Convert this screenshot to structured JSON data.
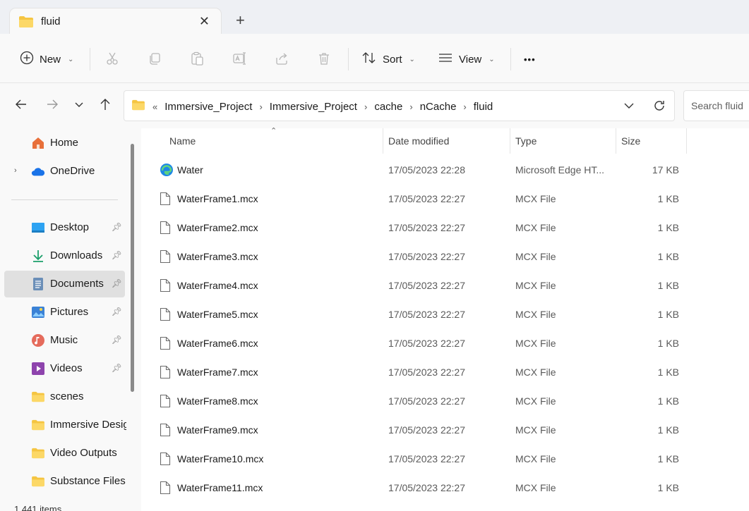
{
  "tab": {
    "title": "fluid",
    "close": "✕",
    "new_tab": "+"
  },
  "toolbar": {
    "new_label": "New",
    "sort_label": "Sort",
    "view_label": "View",
    "more_label": "•••"
  },
  "address": {
    "overflow": "«",
    "crumbs": [
      "Immersive_Project",
      "Immersive_Project",
      "cache",
      "nCache",
      "fluid"
    ],
    "separator": "›"
  },
  "search": {
    "placeholder": "Search fluid"
  },
  "sidebar": {
    "items": [
      {
        "label": "Home",
        "icon": "home-icon"
      },
      {
        "label": "OneDrive",
        "icon": "cloud-icon"
      },
      {
        "label": "Desktop",
        "icon": "desktop-icon",
        "pinned": true
      },
      {
        "label": "Downloads",
        "icon": "download-icon",
        "pinned": true
      },
      {
        "label": "Documents",
        "icon": "document-icon",
        "pinned": true,
        "selected": true
      },
      {
        "label": "Pictures",
        "icon": "pictures-icon",
        "pinned": true
      },
      {
        "label": "Music",
        "icon": "music-icon",
        "pinned": true
      },
      {
        "label": "Videos",
        "icon": "videos-icon",
        "pinned": true
      },
      {
        "label": "scenes",
        "icon": "folder-icon"
      },
      {
        "label": "Immersive Design",
        "icon": "folder-icon"
      },
      {
        "label": "Video Outputs",
        "icon": "folder-icon"
      },
      {
        "label": "Substance Files",
        "icon": "folder-icon"
      }
    ]
  },
  "status": {
    "items_count": "1,441 items"
  },
  "columns": {
    "name": "Name",
    "date": "Date modified",
    "type": "Type",
    "size": "Size"
  },
  "files": [
    {
      "name": "Water",
      "date": "17/05/2023 22:28",
      "type": "Microsoft Edge HT...",
      "size": "17 KB",
      "icon": "edge-icon"
    },
    {
      "name": "WaterFrame1.mcx",
      "date": "17/05/2023 22:27",
      "type": "MCX File",
      "size": "1 KB",
      "icon": "file-icon"
    },
    {
      "name": "WaterFrame2.mcx",
      "date": "17/05/2023 22:27",
      "type": "MCX File",
      "size": "1 KB",
      "icon": "file-icon"
    },
    {
      "name": "WaterFrame3.mcx",
      "date": "17/05/2023 22:27",
      "type": "MCX File",
      "size": "1 KB",
      "icon": "file-icon"
    },
    {
      "name": "WaterFrame4.mcx",
      "date": "17/05/2023 22:27",
      "type": "MCX File",
      "size": "1 KB",
      "icon": "file-icon"
    },
    {
      "name": "WaterFrame5.mcx",
      "date": "17/05/2023 22:27",
      "type": "MCX File",
      "size": "1 KB",
      "icon": "file-icon"
    },
    {
      "name": "WaterFrame6.mcx",
      "date": "17/05/2023 22:27",
      "type": "MCX File",
      "size": "1 KB",
      "icon": "file-icon"
    },
    {
      "name": "WaterFrame7.mcx",
      "date": "17/05/2023 22:27",
      "type": "MCX File",
      "size": "1 KB",
      "icon": "file-icon"
    },
    {
      "name": "WaterFrame8.mcx",
      "date": "17/05/2023 22:27",
      "type": "MCX File",
      "size": "1 KB",
      "icon": "file-icon"
    },
    {
      "name": "WaterFrame9.mcx",
      "date": "17/05/2023 22:27",
      "type": "MCX File",
      "size": "1 KB",
      "icon": "file-icon"
    },
    {
      "name": "WaterFrame10.mcx",
      "date": "17/05/2023 22:27",
      "type": "MCX File",
      "size": "1 KB",
      "icon": "file-icon"
    },
    {
      "name": "WaterFrame11.mcx",
      "date": "17/05/2023 22:27",
      "type": "MCX File",
      "size": "1 KB",
      "icon": "file-icon"
    }
  ],
  "colors": {
    "folder": "#f5c542",
    "edge": "#1e88e5",
    "selected": "#e0e0e0"
  }
}
